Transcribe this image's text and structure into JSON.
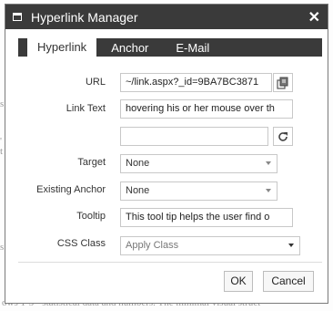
{
  "background": {
    "left_fragments": [
      "s",
      "'",
      "t",
      "s"
    ],
    "bottom_text": "ows 1-5 · statistical data and numbers. The minimal visual struct"
  },
  "dialog": {
    "title": "Hyperlink Manager",
    "tabs": [
      {
        "label": "Hyperlink",
        "active": true
      },
      {
        "label": "Anchor",
        "active": false
      },
      {
        "label": "E-Mail",
        "active": false
      }
    ],
    "fields": {
      "url": {
        "label": "URL",
        "value": "~/link.aspx?_id=9BA7BC3871"
      },
      "link_text": {
        "label": "Link Text",
        "value": "hovering his or her mouse over th"
      },
      "extra": {
        "value": ""
      },
      "target": {
        "label": "Target",
        "value": "None"
      },
      "existing_anchor": {
        "label": "Existing Anchor",
        "value": "None"
      },
      "tooltip": {
        "label": "Tooltip",
        "value": "This tool tip helps the user find o"
      },
      "css_class": {
        "label": "CSS Class",
        "value": "Apply Class"
      }
    },
    "buttons": {
      "ok": "OK",
      "cancel": "Cancel"
    }
  },
  "colors": {
    "titlebar": "#3a3a3a",
    "tabstrip": "#3a3a3a",
    "border": "#c8c8c8"
  }
}
